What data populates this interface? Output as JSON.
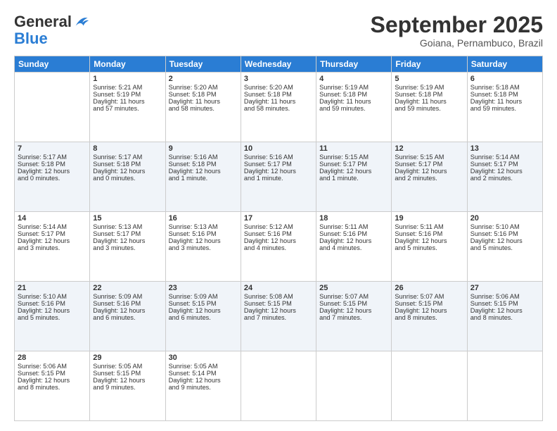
{
  "logo": {
    "line1": "General",
    "line2": "Blue"
  },
  "title": "September 2025",
  "subtitle": "Goiana, Pernambuco, Brazil",
  "headers": [
    "Sunday",
    "Monday",
    "Tuesday",
    "Wednesday",
    "Thursday",
    "Friday",
    "Saturday"
  ],
  "weeks": [
    [
      {
        "day": "",
        "info": ""
      },
      {
        "day": "1",
        "info": "Sunrise: 5:21 AM\nSunset: 5:19 PM\nDaylight: 11 hours\nand 57 minutes."
      },
      {
        "day": "2",
        "info": "Sunrise: 5:20 AM\nSunset: 5:18 PM\nDaylight: 11 hours\nand 58 minutes."
      },
      {
        "day": "3",
        "info": "Sunrise: 5:20 AM\nSunset: 5:18 PM\nDaylight: 11 hours\nand 58 minutes."
      },
      {
        "day": "4",
        "info": "Sunrise: 5:19 AM\nSunset: 5:18 PM\nDaylight: 11 hours\nand 59 minutes."
      },
      {
        "day": "5",
        "info": "Sunrise: 5:19 AM\nSunset: 5:18 PM\nDaylight: 11 hours\nand 59 minutes."
      },
      {
        "day": "6",
        "info": "Sunrise: 5:18 AM\nSunset: 5:18 PM\nDaylight: 11 hours\nand 59 minutes."
      }
    ],
    [
      {
        "day": "7",
        "info": "Sunrise: 5:17 AM\nSunset: 5:18 PM\nDaylight: 12 hours\nand 0 minutes."
      },
      {
        "day": "8",
        "info": "Sunrise: 5:17 AM\nSunset: 5:18 PM\nDaylight: 12 hours\nand 0 minutes."
      },
      {
        "day": "9",
        "info": "Sunrise: 5:16 AM\nSunset: 5:18 PM\nDaylight: 12 hours\nand 1 minute."
      },
      {
        "day": "10",
        "info": "Sunrise: 5:16 AM\nSunset: 5:17 PM\nDaylight: 12 hours\nand 1 minute."
      },
      {
        "day": "11",
        "info": "Sunrise: 5:15 AM\nSunset: 5:17 PM\nDaylight: 12 hours\nand 1 minute."
      },
      {
        "day": "12",
        "info": "Sunrise: 5:15 AM\nSunset: 5:17 PM\nDaylight: 12 hours\nand 2 minutes."
      },
      {
        "day": "13",
        "info": "Sunrise: 5:14 AM\nSunset: 5:17 PM\nDaylight: 12 hours\nand 2 minutes."
      }
    ],
    [
      {
        "day": "14",
        "info": "Sunrise: 5:14 AM\nSunset: 5:17 PM\nDaylight: 12 hours\nand 3 minutes."
      },
      {
        "day": "15",
        "info": "Sunrise: 5:13 AM\nSunset: 5:17 PM\nDaylight: 12 hours\nand 3 minutes."
      },
      {
        "day": "16",
        "info": "Sunrise: 5:13 AM\nSunset: 5:16 PM\nDaylight: 12 hours\nand 3 minutes."
      },
      {
        "day": "17",
        "info": "Sunrise: 5:12 AM\nSunset: 5:16 PM\nDaylight: 12 hours\nand 4 minutes."
      },
      {
        "day": "18",
        "info": "Sunrise: 5:11 AM\nSunset: 5:16 PM\nDaylight: 12 hours\nand 4 minutes."
      },
      {
        "day": "19",
        "info": "Sunrise: 5:11 AM\nSunset: 5:16 PM\nDaylight: 12 hours\nand 5 minutes."
      },
      {
        "day": "20",
        "info": "Sunrise: 5:10 AM\nSunset: 5:16 PM\nDaylight: 12 hours\nand 5 minutes."
      }
    ],
    [
      {
        "day": "21",
        "info": "Sunrise: 5:10 AM\nSunset: 5:16 PM\nDaylight: 12 hours\nand 5 minutes."
      },
      {
        "day": "22",
        "info": "Sunrise: 5:09 AM\nSunset: 5:16 PM\nDaylight: 12 hours\nand 6 minutes."
      },
      {
        "day": "23",
        "info": "Sunrise: 5:09 AM\nSunset: 5:15 PM\nDaylight: 12 hours\nand 6 minutes."
      },
      {
        "day": "24",
        "info": "Sunrise: 5:08 AM\nSunset: 5:15 PM\nDaylight: 12 hours\nand 7 minutes."
      },
      {
        "day": "25",
        "info": "Sunrise: 5:07 AM\nSunset: 5:15 PM\nDaylight: 12 hours\nand 7 minutes."
      },
      {
        "day": "26",
        "info": "Sunrise: 5:07 AM\nSunset: 5:15 PM\nDaylight: 12 hours\nand 8 minutes."
      },
      {
        "day": "27",
        "info": "Sunrise: 5:06 AM\nSunset: 5:15 PM\nDaylight: 12 hours\nand 8 minutes."
      }
    ],
    [
      {
        "day": "28",
        "info": "Sunrise: 5:06 AM\nSunset: 5:15 PM\nDaylight: 12 hours\nand 8 minutes."
      },
      {
        "day": "29",
        "info": "Sunrise: 5:05 AM\nSunset: 5:15 PM\nDaylight: 12 hours\nand 9 minutes."
      },
      {
        "day": "30",
        "info": "Sunrise: 5:05 AM\nSunset: 5:14 PM\nDaylight: 12 hours\nand 9 minutes."
      },
      {
        "day": "",
        "info": ""
      },
      {
        "day": "",
        "info": ""
      },
      {
        "day": "",
        "info": ""
      },
      {
        "day": "",
        "info": ""
      }
    ]
  ]
}
